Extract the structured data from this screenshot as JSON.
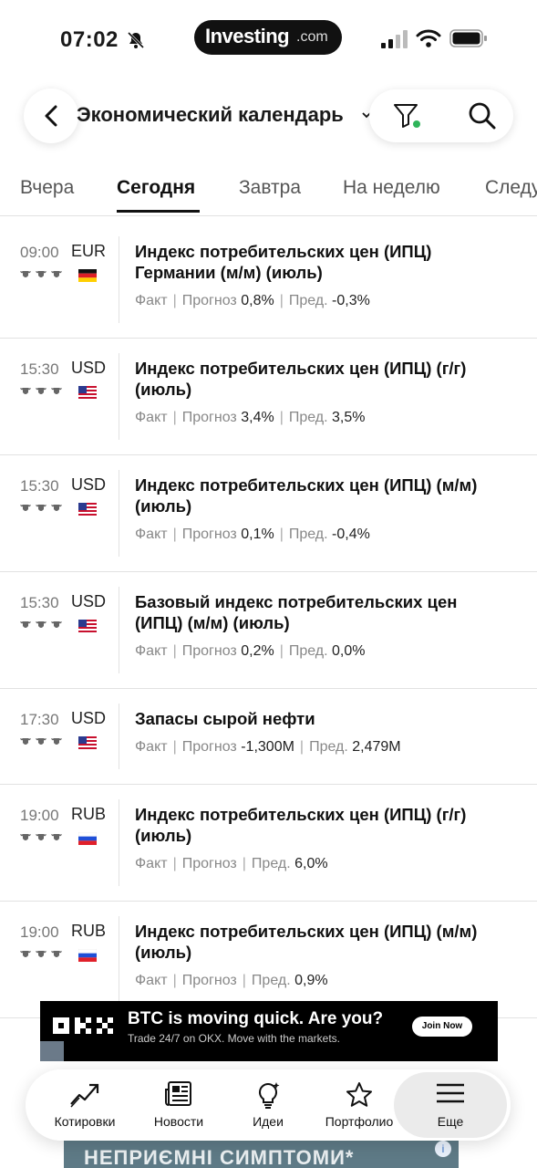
{
  "status_bar": {
    "time": "07:02",
    "logo_brand": "Investing",
    "logo_suffix": ".com"
  },
  "header": {
    "title": "Экономический календарь",
    "icons": [
      "back-chevron-icon",
      "filter-icon",
      "search-icon"
    ]
  },
  "tabs": [
    {
      "label": "Вчера",
      "active": false
    },
    {
      "label": "Сегодня",
      "active": true
    },
    {
      "label": "Завтра",
      "active": false
    },
    {
      "label": "На неделю",
      "active": false
    },
    {
      "label": "Следу",
      "active": false
    }
  ],
  "meta_labels": {
    "fact": "Факт",
    "forecast": "Прогноз",
    "previous": "Пред."
  },
  "events": [
    {
      "time": "09:00",
      "currency": "EUR",
      "flag": "de",
      "importance": 3,
      "title": "Индекс потребительских цен (ИПЦ) Германии (м/м) (июль)",
      "actual": "",
      "forecast": "0,8%",
      "previous": "-0,3%"
    },
    {
      "time": "15:30",
      "currency": "USD",
      "flag": "us",
      "importance": 3,
      "title": "Индекс потребительских цен (ИПЦ) (г/г) (июль)",
      "actual": "",
      "forecast": "3,4%",
      "previous": "3,5%"
    },
    {
      "time": "15:30",
      "currency": "USD",
      "flag": "us",
      "importance": 3,
      "title": "Индекс потребительских цен (ИПЦ) (м/м) (июль)",
      "actual": "",
      "forecast": "0,1%",
      "previous": "-0,4%"
    },
    {
      "time": "15:30",
      "currency": "USD",
      "flag": "us",
      "importance": 3,
      "title": "Базовый индекс потребительских цен (ИПЦ) (м/м) (июль)",
      "actual": "",
      "forecast": "0,2%",
      "previous": "0,0%"
    },
    {
      "time": "17:30",
      "currency": "USD",
      "flag": "us",
      "importance": 3,
      "title": "Запасы сырой нефти",
      "actual": "",
      "forecast": "-1,300M",
      "previous": "2,479M"
    },
    {
      "time": "19:00",
      "currency": "RUB",
      "flag": "ru",
      "importance": 3,
      "title": "Индекс потребительских цен (ИПЦ) (г/г) (июль)",
      "actual": "",
      "forecast": "",
      "previous": "6,0%"
    },
    {
      "time": "19:00",
      "currency": "RUB",
      "flag": "ru",
      "importance": 3,
      "title": "Индекс потребительских цен (ИПЦ) (м/м) (июль)",
      "actual": "",
      "forecast": "",
      "previous": "0,9%"
    }
  ],
  "ad_banner": {
    "brand": "OKX",
    "headline": "BTC is moving quick. Are you?",
    "subline": "Trade 24/7 on OKX. Move with the markets.",
    "button": "Join Now"
  },
  "bottom_nav": [
    {
      "label": "Котировки",
      "icon": "chart-trend-icon",
      "active": false
    },
    {
      "label": "Новости",
      "icon": "newspaper-icon",
      "active": false
    },
    {
      "label": "Идеи",
      "icon": "lightbulb-icon",
      "active": false
    },
    {
      "label": "Портфолио",
      "icon": "star-icon",
      "active": false
    },
    {
      "label": "Еще",
      "icon": "menu-icon",
      "active": true
    }
  ],
  "bottom_ad": {
    "text": "НЕПРИЄМНІ СИМПТОМИ*"
  }
}
